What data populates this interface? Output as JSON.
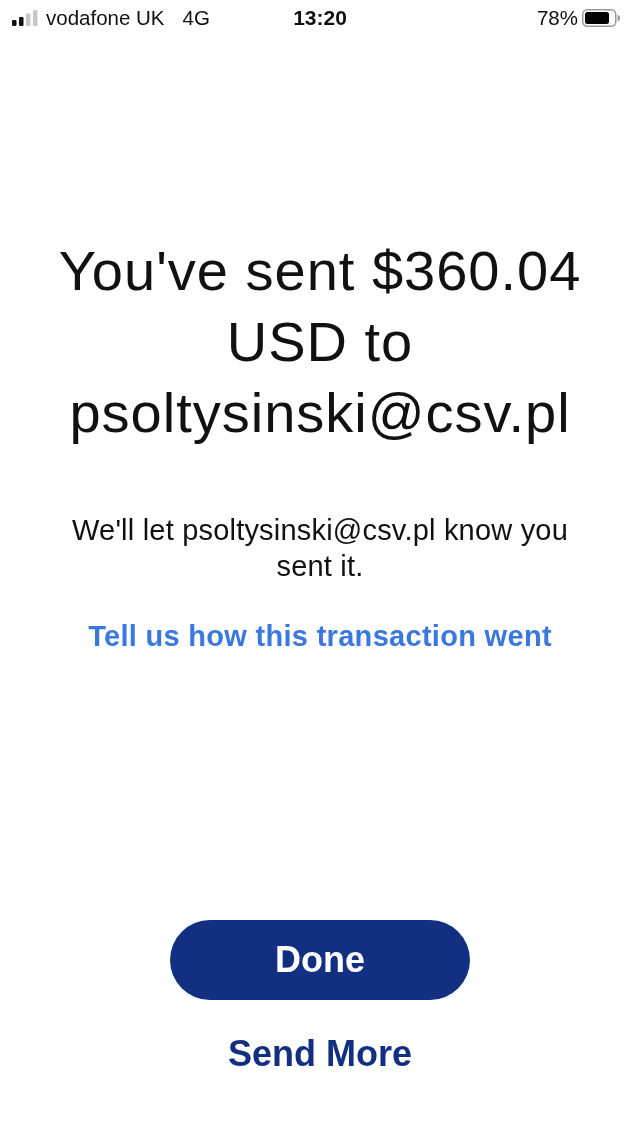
{
  "status_bar": {
    "carrier": "vodafone UK",
    "network": "4G",
    "time": "13:20",
    "battery": "78%"
  },
  "confirmation": {
    "title": "You've sent $360.04 USD to psoltysinski@csv.pl",
    "message": "We'll let psoltysinski@csv.pl know you sent it.",
    "feedback_link": "Tell us how this transaction went"
  },
  "buttons": [
    {
      "label": "Done",
      "kind": "primary"
    },
    {
      "label": "Send More",
      "kind": "text"
    }
  ]
}
